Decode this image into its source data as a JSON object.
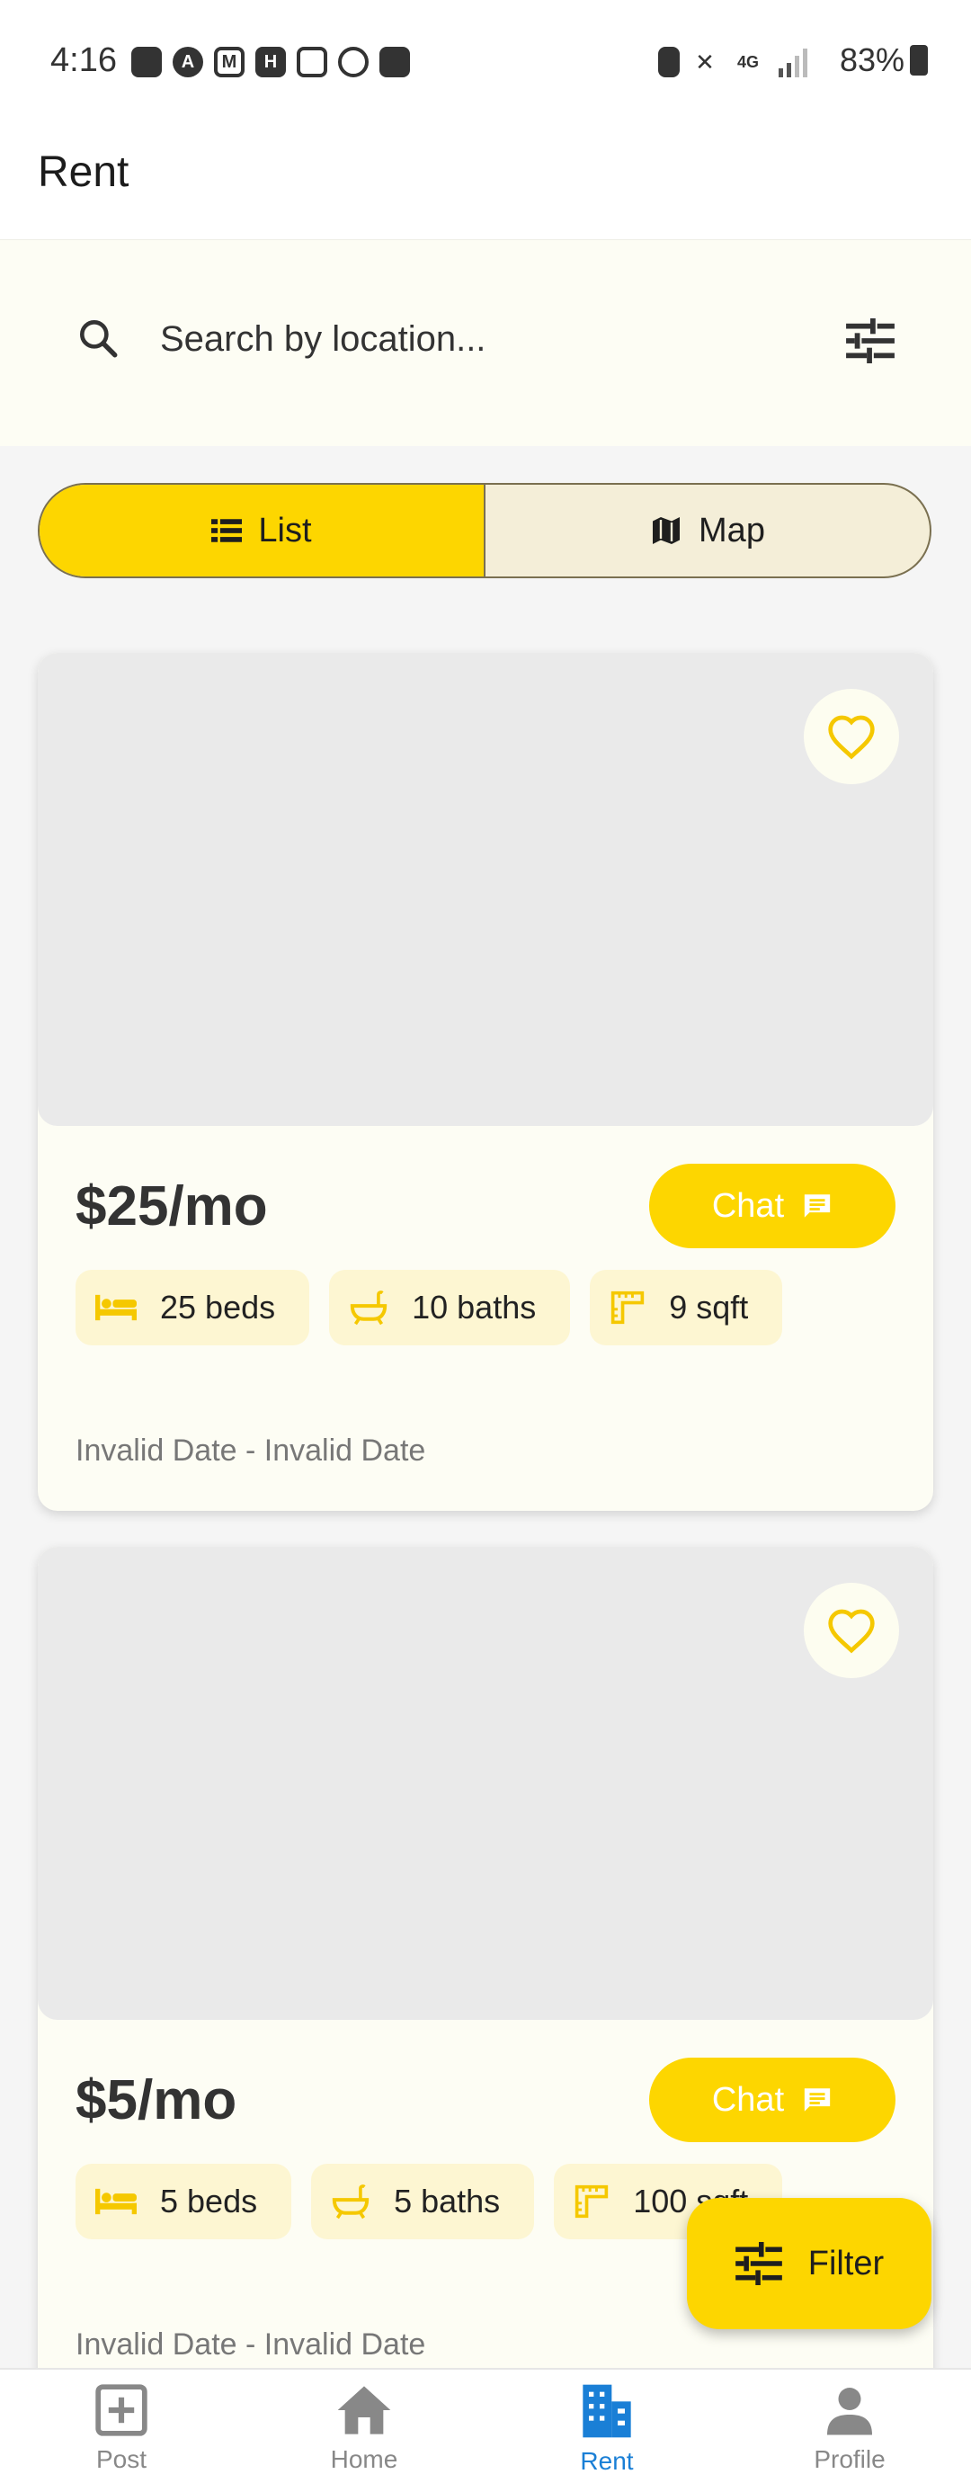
{
  "status_bar": {
    "time": "4:16",
    "battery": "83%"
  },
  "header": {
    "title": "Rent"
  },
  "search": {
    "placeholder": "Search by location..."
  },
  "view_toggle": {
    "list_label": "List",
    "map_label": "Map",
    "selected": "List"
  },
  "listings": [
    {
      "price": "$25/mo",
      "chat_label": "Chat",
      "beds": "25 beds",
      "baths": "10 baths",
      "area": "9 sqft",
      "date_range": "Invalid Date - Invalid Date"
    },
    {
      "price": "$5/mo",
      "chat_label": "Chat",
      "beds": "5 beds",
      "baths": "5 baths",
      "area": "100 sqft",
      "date_range": "Invalid Date - Invalid Date"
    }
  ],
  "filter_fab": {
    "label": "Filter"
  },
  "bottom_nav": {
    "items": [
      {
        "label": "Post",
        "icon": "add-box-icon"
      },
      {
        "label": "Home",
        "icon": "home-icon"
      },
      {
        "label": "Rent",
        "icon": "building-icon"
      },
      {
        "label": "Profile",
        "icon": "person-icon"
      }
    ],
    "active": "Rent"
  },
  "colors": {
    "accent": "#fdd600",
    "active_nav": "#1a7fd6",
    "card_bg": "#fdfdf4",
    "chip_bg": "#fdf6d2"
  }
}
